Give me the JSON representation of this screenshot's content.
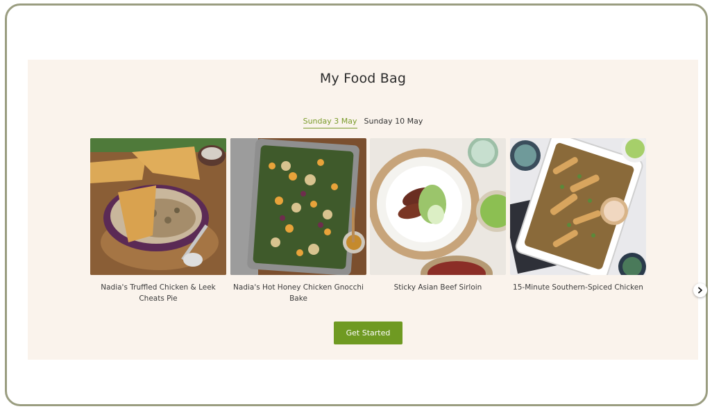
{
  "page": {
    "title": "My Food Bag"
  },
  "tabs": [
    {
      "label": "Sunday 3 May",
      "active": true
    },
    {
      "label": "Sunday 10 May",
      "active": false
    }
  ],
  "recipes": [
    {
      "name": "Nadia's Truffled Chicken & Leek Cheats Pie",
      "image": "chicken-leek-pie-photo"
    },
    {
      "name": "Nadia's Hot Honey Chicken Gnocchi Bake",
      "image": "gnocchi-bake-photo"
    },
    {
      "name": "Sticky Asian Beef Sirloin",
      "image": "asian-beef-photo"
    },
    {
      "name": "15-Minute Southern-Spiced Chicken",
      "image": "southern-chicken-photo"
    }
  ],
  "cta": {
    "label": "Get Started"
  },
  "colors": {
    "accent": "#6f9a22",
    "panel_bg": "#faf3ec",
    "active_tab": "#7a9b2b",
    "frame": "#9a9d80"
  }
}
